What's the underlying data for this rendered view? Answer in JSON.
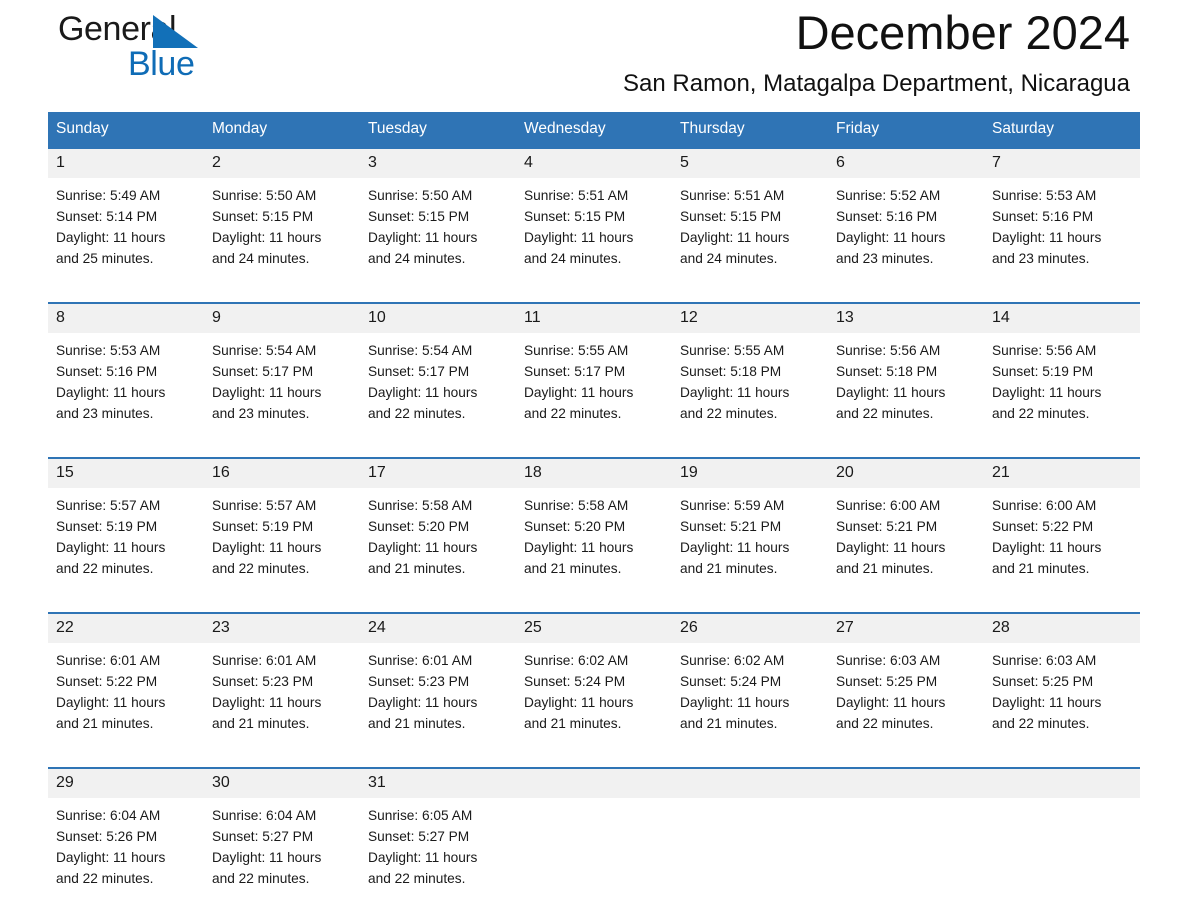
{
  "brand": {
    "name_part1": "General",
    "name_part2": "Blue",
    "triangle_color": "#1270b8",
    "blue_color": "#0f6cb6"
  },
  "header": {
    "title": "December 2024",
    "subtitle": "San Ramon, Matagalpa Department, Nicaragua"
  },
  "theme": {
    "header_blue": "#2f74b5",
    "daynum_band": "#f1f1f1",
    "text": "#1a1a1a"
  },
  "weekdays": [
    "Sunday",
    "Monday",
    "Tuesday",
    "Wednesday",
    "Thursday",
    "Friday",
    "Saturday"
  ],
  "labels": {
    "sunrise_prefix": "Sunrise:",
    "sunset_prefix": "Sunset:",
    "daylight_prefix": "Daylight:"
  },
  "weeks": [
    {
      "days": [
        {
          "num": "1",
          "sunrise": "Sunrise: 5:49 AM",
          "sunset": "Sunset: 5:14 PM",
          "daylight_l1": "Daylight: 11 hours",
          "daylight_l2": "and 25 minutes."
        },
        {
          "num": "2",
          "sunrise": "Sunrise: 5:50 AM",
          "sunset": "Sunset: 5:15 PM",
          "daylight_l1": "Daylight: 11 hours",
          "daylight_l2": "and 24 minutes."
        },
        {
          "num": "3",
          "sunrise": "Sunrise: 5:50 AM",
          "sunset": "Sunset: 5:15 PM",
          "daylight_l1": "Daylight: 11 hours",
          "daylight_l2": "and 24 minutes."
        },
        {
          "num": "4",
          "sunrise": "Sunrise: 5:51 AM",
          "sunset": "Sunset: 5:15 PM",
          "daylight_l1": "Daylight: 11 hours",
          "daylight_l2": "and 24 minutes."
        },
        {
          "num": "5",
          "sunrise": "Sunrise: 5:51 AM",
          "sunset": "Sunset: 5:15 PM",
          "daylight_l1": "Daylight: 11 hours",
          "daylight_l2": "and 24 minutes."
        },
        {
          "num": "6",
          "sunrise": "Sunrise: 5:52 AM",
          "sunset": "Sunset: 5:16 PM",
          "daylight_l1": "Daylight: 11 hours",
          "daylight_l2": "and 23 minutes."
        },
        {
          "num": "7",
          "sunrise": "Sunrise: 5:53 AM",
          "sunset": "Sunset: 5:16 PM",
          "daylight_l1": "Daylight: 11 hours",
          "daylight_l2": "and 23 minutes."
        }
      ]
    },
    {
      "days": [
        {
          "num": "8",
          "sunrise": "Sunrise: 5:53 AM",
          "sunset": "Sunset: 5:16 PM",
          "daylight_l1": "Daylight: 11 hours",
          "daylight_l2": "and 23 minutes."
        },
        {
          "num": "9",
          "sunrise": "Sunrise: 5:54 AM",
          "sunset": "Sunset: 5:17 PM",
          "daylight_l1": "Daylight: 11 hours",
          "daylight_l2": "and 23 minutes."
        },
        {
          "num": "10",
          "sunrise": "Sunrise: 5:54 AM",
          "sunset": "Sunset: 5:17 PM",
          "daylight_l1": "Daylight: 11 hours",
          "daylight_l2": "and 22 minutes."
        },
        {
          "num": "11",
          "sunrise": "Sunrise: 5:55 AM",
          "sunset": "Sunset: 5:17 PM",
          "daylight_l1": "Daylight: 11 hours",
          "daylight_l2": "and 22 minutes."
        },
        {
          "num": "12",
          "sunrise": "Sunrise: 5:55 AM",
          "sunset": "Sunset: 5:18 PM",
          "daylight_l1": "Daylight: 11 hours",
          "daylight_l2": "and 22 minutes."
        },
        {
          "num": "13",
          "sunrise": "Sunrise: 5:56 AM",
          "sunset": "Sunset: 5:18 PM",
          "daylight_l1": "Daylight: 11 hours",
          "daylight_l2": "and 22 minutes."
        },
        {
          "num": "14",
          "sunrise": "Sunrise: 5:56 AM",
          "sunset": "Sunset: 5:19 PM",
          "daylight_l1": "Daylight: 11 hours",
          "daylight_l2": "and 22 minutes."
        }
      ]
    },
    {
      "days": [
        {
          "num": "15",
          "sunrise": "Sunrise: 5:57 AM",
          "sunset": "Sunset: 5:19 PM",
          "daylight_l1": "Daylight: 11 hours",
          "daylight_l2": "and 22 minutes."
        },
        {
          "num": "16",
          "sunrise": "Sunrise: 5:57 AM",
          "sunset": "Sunset: 5:19 PM",
          "daylight_l1": "Daylight: 11 hours",
          "daylight_l2": "and 22 minutes."
        },
        {
          "num": "17",
          "sunrise": "Sunrise: 5:58 AM",
          "sunset": "Sunset: 5:20 PM",
          "daylight_l1": "Daylight: 11 hours",
          "daylight_l2": "and 21 minutes."
        },
        {
          "num": "18",
          "sunrise": "Sunrise: 5:58 AM",
          "sunset": "Sunset: 5:20 PM",
          "daylight_l1": "Daylight: 11 hours",
          "daylight_l2": "and 21 minutes."
        },
        {
          "num": "19",
          "sunrise": "Sunrise: 5:59 AM",
          "sunset": "Sunset: 5:21 PM",
          "daylight_l1": "Daylight: 11 hours",
          "daylight_l2": "and 21 minutes."
        },
        {
          "num": "20",
          "sunrise": "Sunrise: 6:00 AM",
          "sunset": "Sunset: 5:21 PM",
          "daylight_l1": "Daylight: 11 hours",
          "daylight_l2": "and 21 minutes."
        },
        {
          "num": "21",
          "sunrise": "Sunrise: 6:00 AM",
          "sunset": "Sunset: 5:22 PM",
          "daylight_l1": "Daylight: 11 hours",
          "daylight_l2": "and 21 minutes."
        }
      ]
    },
    {
      "days": [
        {
          "num": "22",
          "sunrise": "Sunrise: 6:01 AM",
          "sunset": "Sunset: 5:22 PM",
          "daylight_l1": "Daylight: 11 hours",
          "daylight_l2": "and 21 minutes."
        },
        {
          "num": "23",
          "sunrise": "Sunrise: 6:01 AM",
          "sunset": "Sunset: 5:23 PM",
          "daylight_l1": "Daylight: 11 hours",
          "daylight_l2": "and 21 minutes."
        },
        {
          "num": "24",
          "sunrise": "Sunrise: 6:01 AM",
          "sunset": "Sunset: 5:23 PM",
          "daylight_l1": "Daylight: 11 hours",
          "daylight_l2": "and 21 minutes."
        },
        {
          "num": "25",
          "sunrise": "Sunrise: 6:02 AM",
          "sunset": "Sunset: 5:24 PM",
          "daylight_l1": "Daylight: 11 hours",
          "daylight_l2": "and 21 minutes."
        },
        {
          "num": "26",
          "sunrise": "Sunrise: 6:02 AM",
          "sunset": "Sunset: 5:24 PM",
          "daylight_l1": "Daylight: 11 hours",
          "daylight_l2": "and 21 minutes."
        },
        {
          "num": "27",
          "sunrise": "Sunrise: 6:03 AM",
          "sunset": "Sunset: 5:25 PM",
          "daylight_l1": "Daylight: 11 hours",
          "daylight_l2": "and 22 minutes."
        },
        {
          "num": "28",
          "sunrise": "Sunrise: 6:03 AM",
          "sunset": "Sunset: 5:25 PM",
          "daylight_l1": "Daylight: 11 hours",
          "daylight_l2": "and 22 minutes."
        }
      ]
    },
    {
      "days": [
        {
          "num": "29",
          "sunrise": "Sunrise: 6:04 AM",
          "sunset": "Sunset: 5:26 PM",
          "daylight_l1": "Daylight: 11 hours",
          "daylight_l2": "and 22 minutes."
        },
        {
          "num": "30",
          "sunrise": "Sunrise: 6:04 AM",
          "sunset": "Sunset: 5:27 PM",
          "daylight_l1": "Daylight: 11 hours",
          "daylight_l2": "and 22 minutes."
        },
        {
          "num": "31",
          "sunrise": "Sunrise: 6:05 AM",
          "sunset": "Sunset: 5:27 PM",
          "daylight_l1": "Daylight: 11 hours",
          "daylight_l2": "and 22 minutes."
        },
        {
          "num": "",
          "sunrise": "",
          "sunset": "",
          "daylight_l1": "",
          "daylight_l2": ""
        },
        {
          "num": "",
          "sunrise": "",
          "sunset": "",
          "daylight_l1": "",
          "daylight_l2": ""
        },
        {
          "num": "",
          "sunrise": "",
          "sunset": "",
          "daylight_l1": "",
          "daylight_l2": ""
        },
        {
          "num": "",
          "sunrise": "",
          "sunset": "",
          "daylight_l1": "",
          "daylight_l2": ""
        }
      ]
    }
  ]
}
